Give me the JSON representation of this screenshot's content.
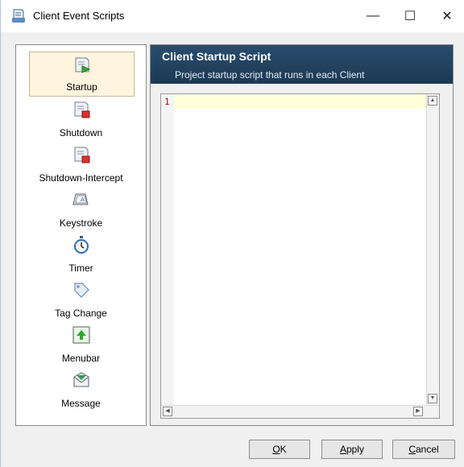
{
  "window": {
    "title": "Client Event Scripts",
    "controls": {
      "minimize": "—",
      "maximize": "☐",
      "close": "✕"
    }
  },
  "sidebar": {
    "items": [
      {
        "label": "Startup",
        "icon": "script-startup-icon",
        "selected": true
      },
      {
        "label": "Shutdown",
        "icon": "script-shutdown-icon"
      },
      {
        "label": "Shutdown-Intercept",
        "icon": "script-shutdown-intercept-icon"
      },
      {
        "label": "Keystroke",
        "icon": "keystroke-icon"
      },
      {
        "label": "Timer",
        "icon": "timer-icon"
      },
      {
        "label": "Tag Change",
        "icon": "tag-icon"
      },
      {
        "label": "Menubar",
        "icon": "menubar-icon"
      },
      {
        "label": "Message",
        "icon": "message-icon"
      }
    ]
  },
  "panel": {
    "title": "Client Startup Script",
    "description": "Project startup script that runs in each Client"
  },
  "editor": {
    "line_number": "1",
    "content": ""
  },
  "buttons": {
    "ok": {
      "accel": "O",
      "rest": "K"
    },
    "apply": {
      "accel": "A",
      "rest": "pply"
    },
    "cancel": {
      "accel": "C",
      "rest": "ancel"
    }
  },
  "colors": {
    "header_bg": "#1b3954",
    "selected_bg": "#fff4dd",
    "current_line": "#ffffd8"
  }
}
